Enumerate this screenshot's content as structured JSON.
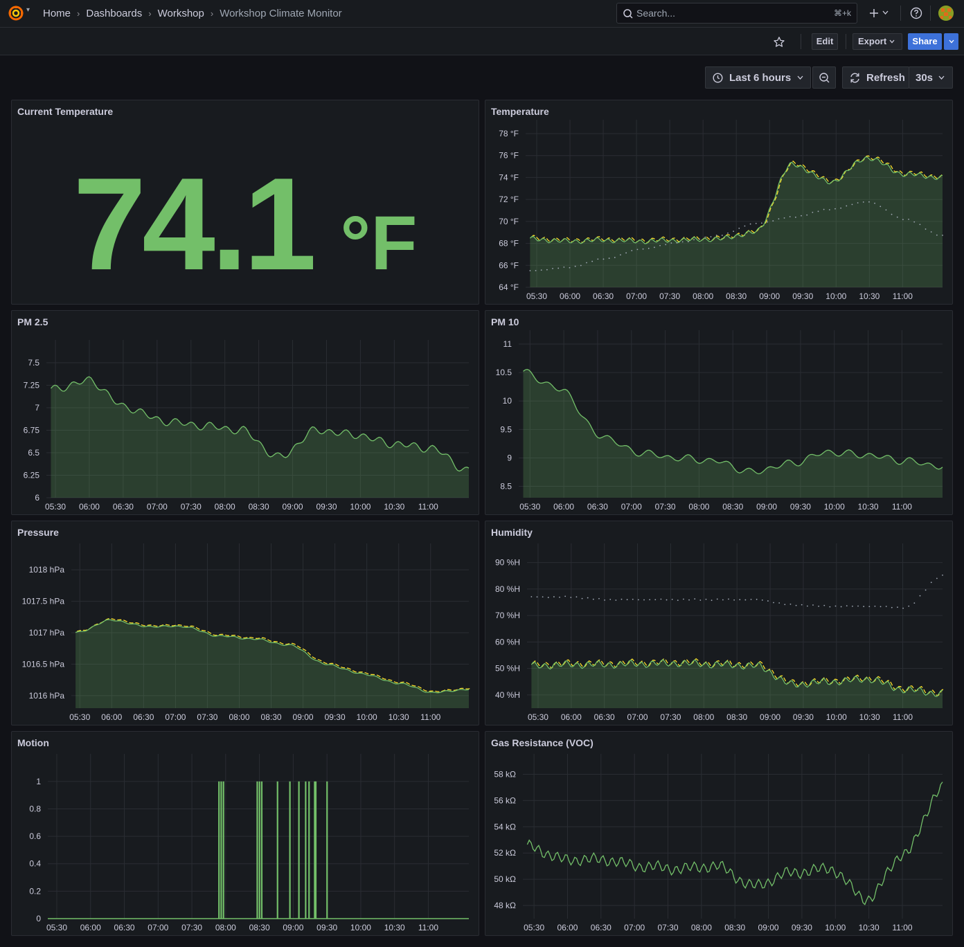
{
  "nav": {
    "breadcrumbs": [
      "Home",
      "Dashboards",
      "Workshop",
      "Workshop Climate Monitor"
    ],
    "search_placeholder": "Search...",
    "search_shortcut": "⌘+k"
  },
  "toolbar": {
    "edit_label": "Edit",
    "export_label": "Export",
    "share_label": "Share"
  },
  "time_controls": {
    "range_label": "Last 6 hours",
    "refresh_label": "Refresh",
    "interval_label": "30s"
  },
  "colors": {
    "accent_green": "#73bf69",
    "forecast_yellow": "#fade2a",
    "primary_blue": "#3d71d9"
  },
  "stat_panel": {
    "title": "Current Temperature",
    "value": "74.1",
    "unit": "°F"
  },
  "chart_data": [
    {
      "title": "Temperature",
      "type": "line",
      "x": [
        "05:30",
        "06:00",
        "06:30",
        "07:00",
        "07:30",
        "08:00",
        "08:30",
        "09:00",
        "09:30",
        "10:00",
        "10:30",
        "11:00"
      ],
      "yticks": [
        "64 °F",
        "66 °F",
        "68 °F",
        "70 °F",
        "72 °F",
        "74 °F",
        "76 °F",
        "78 °F"
      ],
      "ylim": [
        64,
        78
      ],
      "series": [
        {
          "values": [
            68.4,
            68.2,
            68.3,
            68.2,
            68.3,
            68.4,
            69.0,
            75.2,
            73.6,
            75.8,
            74.3,
            74.0
          ]
        },
        {
          "values": [
            65.5,
            65.8,
            66.6,
            67.5,
            68.1,
            68.7,
            69.8,
            70.4,
            71.1,
            71.8,
            70.2,
            68.7
          ]
        }
      ]
    },
    {
      "title": "PM 2.5",
      "type": "line",
      "x": [
        "05:30",
        "06:00",
        "06:30",
        "07:00",
        "07:30",
        "08:00",
        "08:30",
        "09:00",
        "09:30",
        "10:00",
        "10:30",
        "11:00"
      ],
      "yticks": [
        "6",
        "6.25",
        "6.5",
        "6.75",
        "7",
        "7.25",
        "7.5"
      ],
      "ylim": [
        6,
        7.6
      ],
      "series": [
        {
          "values": [
            7.2,
            7.3,
            7.0,
            6.85,
            6.8,
            6.75,
            6.45,
            6.75,
            6.7,
            6.6,
            6.55,
            6.3
          ]
        }
      ]
    },
    {
      "title": "PM 10",
      "type": "line",
      "x": [
        "05:30",
        "06:00",
        "06:30",
        "07:00",
        "07:30",
        "08:00",
        "08:30",
        "09:00",
        "09:30",
        "10:00",
        "10:30",
        "11:00"
      ],
      "yticks": [
        "8.5",
        "9",
        "9.5",
        "10",
        "10.5",
        "11"
      ],
      "ylim": [
        8.3,
        11
      ],
      "series": [
        {
          "values": [
            10.5,
            10.2,
            9.4,
            9.1,
            9.0,
            8.95,
            8.75,
            8.9,
            9.1,
            9.05,
            8.95,
            8.85
          ]
        }
      ]
    },
    {
      "title": "Pressure",
      "type": "line",
      "x": [
        "05:30",
        "06:00",
        "06:30",
        "07:00",
        "07:30",
        "08:00",
        "08:30",
        "09:00",
        "09:30",
        "10:00",
        "10:30",
        "11:00"
      ],
      "yticks": [
        "1016 hPa",
        "1016.5 hPa",
        "1017 hPa",
        "1017.5 hPa",
        "1018 hPa"
      ],
      "ylim": [
        1015.8,
        1018.2
      ],
      "series": [
        {
          "values": [
            1017.0,
            1017.2,
            1017.1,
            1017.1,
            1016.95,
            1016.9,
            1016.8,
            1016.5,
            1016.35,
            1016.2,
            1016.05,
            1016.1
          ]
        }
      ]
    },
    {
      "title": "Humidity",
      "type": "line",
      "x": [
        "05:30",
        "06:00",
        "06:30",
        "07:00",
        "07:30",
        "08:00",
        "08:30",
        "09:00",
        "09:30",
        "10:00",
        "10:30",
        "11:00"
      ],
      "yticks": [
        "40 %H",
        "50 %H",
        "60 %H",
        "70 %H",
        "80 %H",
        "90 %H"
      ],
      "ylim": [
        35,
        92
      ],
      "series": [
        {
          "values": [
            51,
            51.5,
            51.5,
            51.8,
            52,
            51.5,
            51,
            44,
            45,
            46,
            42,
            40.5
          ]
        },
        {
          "values": [
            77,
            77,
            76,
            76,
            76,
            76,
            76,
            74,
            73.5,
            73.5,
            73,
            85
          ]
        }
      ]
    },
    {
      "title": "Motion",
      "type": "bar",
      "x": [
        "05:30",
        "06:00",
        "06:30",
        "07:00",
        "07:30",
        "08:00",
        "08:30",
        "09:00",
        "09:30",
        "10:00",
        "10:30",
        "11:00"
      ],
      "yticks": [
        "0",
        "0.2",
        "0.4",
        "0.6",
        "0.8",
        "1"
      ],
      "ylim": [
        0,
        1.1
      ],
      "event_times": [
        "07:54",
        "07:56",
        "07:58",
        "08:28",
        "08:30",
        "08:32",
        "08:46",
        "08:57",
        "09:05",
        "09:11",
        "09:14",
        "09:19",
        "09:20",
        "09:30"
      ]
    },
    {
      "title": "Gas Resistance (VOC)",
      "type": "line",
      "x": [
        "05:30",
        "06:00",
        "06:30",
        "07:00",
        "07:30",
        "08:00",
        "08:30",
        "09:00",
        "09:30",
        "10:00",
        "10:30",
        "11:00"
      ],
      "yticks": [
        "48 kΩ",
        "50 kΩ",
        "52 kΩ",
        "54 kΩ",
        "56 kΩ",
        "58 kΩ"
      ],
      "ylim": [
        47,
        58.5
      ],
      "series": [
        {
          "values": [
            52.5,
            51.5,
            51.5,
            51.0,
            50.8,
            51.0,
            49.5,
            50.5,
            50.8,
            48.5,
            52.0,
            57.0
          ]
        }
      ]
    }
  ]
}
